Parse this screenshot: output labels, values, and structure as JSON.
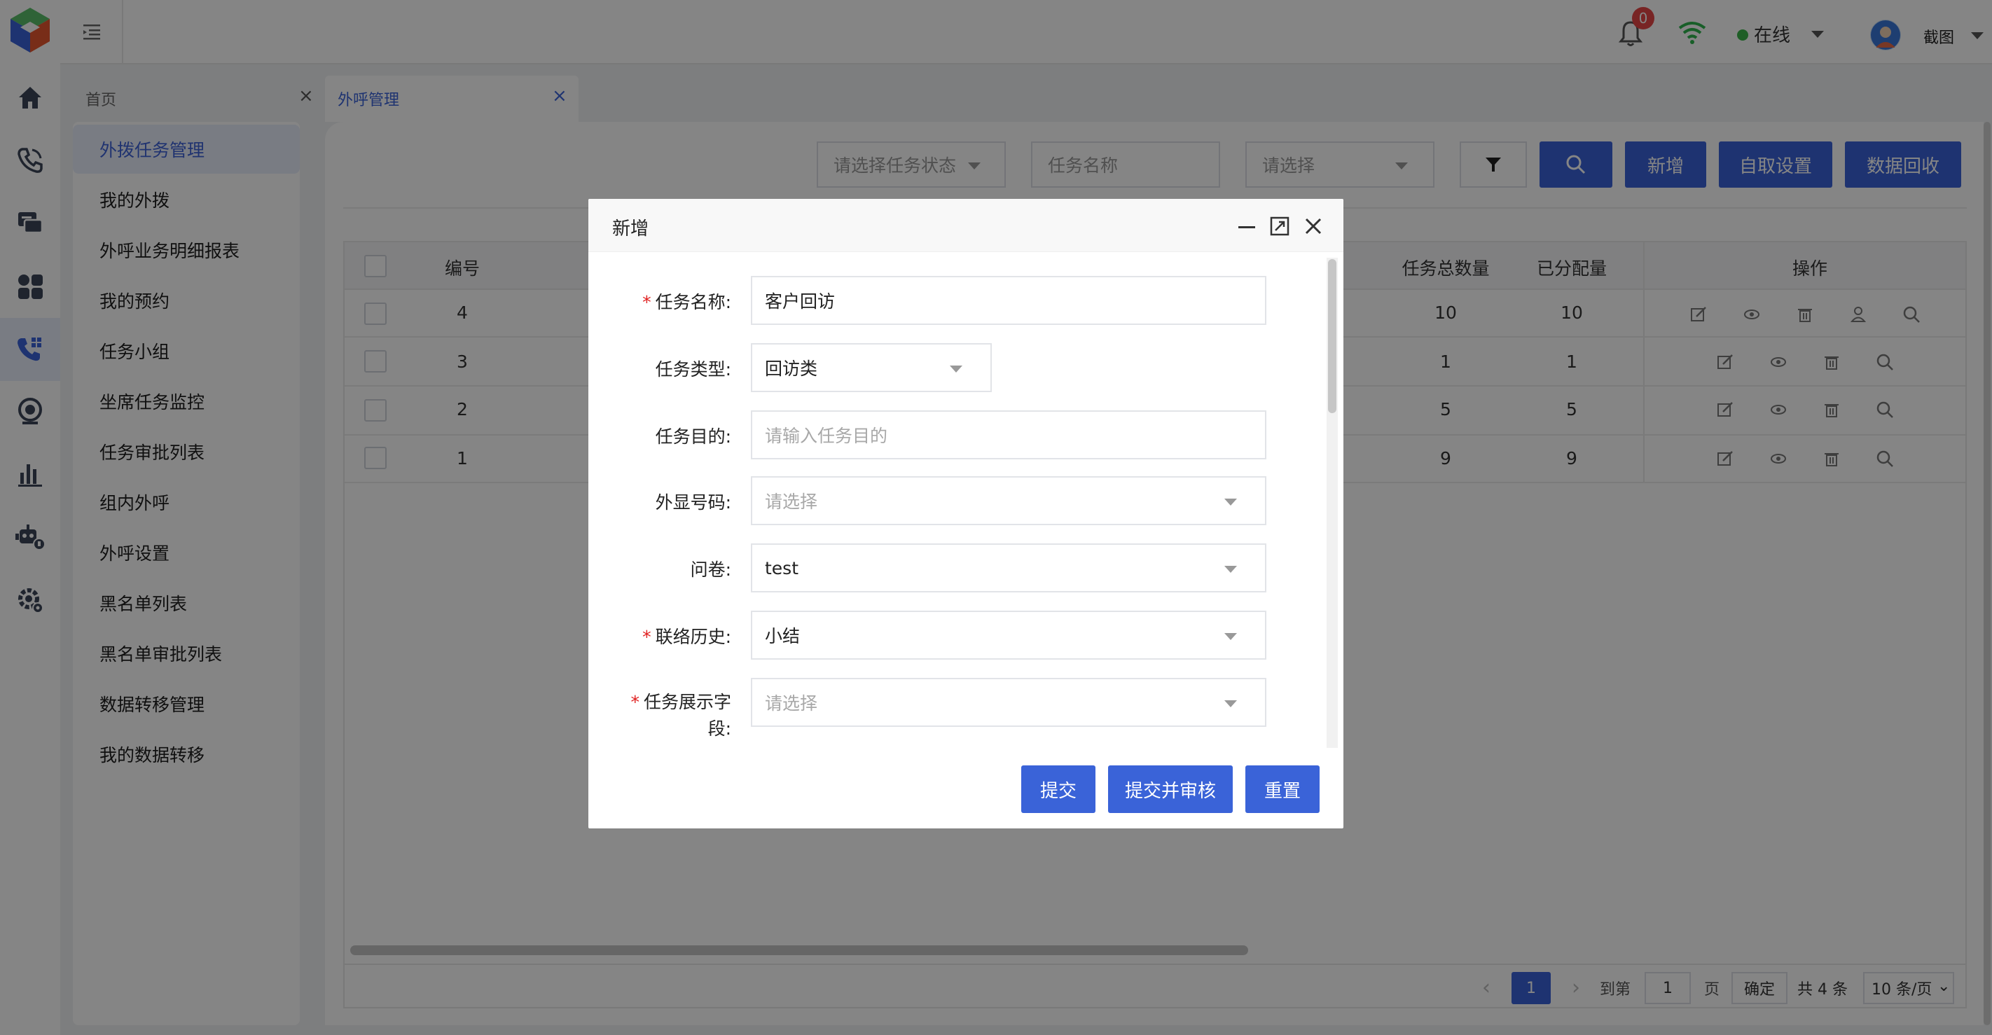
{
  "header": {
    "notification_count": "0",
    "status_label": "在线",
    "user_name": "截图",
    "status_color": "#3bb54a",
    "wifi_color": "#2fb44e"
  },
  "rail": {
    "icons": [
      "logo-icon",
      "home-icon",
      "phone-icon",
      "chat-icon",
      "apps-icon",
      "call-task-icon",
      "monitor-icon",
      "chart-icon",
      "robot-icon",
      "settings-icon"
    ]
  },
  "sidebar": {
    "items": [
      {
        "label": "外拨任务管理",
        "active": true
      },
      {
        "label": "我的外拨"
      },
      {
        "label": "外呼业务明细报表"
      },
      {
        "label": "我的预约"
      },
      {
        "label": "任务小组"
      },
      {
        "label": "坐席任务监控"
      },
      {
        "label": "任务审批列表"
      },
      {
        "label": "组内外呼"
      },
      {
        "label": "外呼设置"
      },
      {
        "label": "黑名单列表"
      },
      {
        "label": "黑名单审批列表"
      },
      {
        "label": "数据转移管理"
      },
      {
        "label": "我的数据转移"
      }
    ]
  },
  "tabs": [
    {
      "label": "首页"
    },
    {
      "label": "外呼管理",
      "active": true
    }
  ],
  "filters": {
    "status_placeholder": "请选择任务状态",
    "name_placeholder": "任务名称",
    "select_placeholder": "请选择"
  },
  "toolbar": {
    "add_label": "新增",
    "self_fetch_label": "自取设置",
    "recycle_label": "数据回收"
  },
  "table": {
    "headers": {
      "id": "编号",
      "total": "任务总数量",
      "assigned": "已分配量",
      "actions": "操作"
    },
    "rows": [
      {
        "id": "4",
        "total": "10",
        "assigned": "10"
      },
      {
        "id": "3",
        "total": "1",
        "assigned": "1"
      },
      {
        "id": "2",
        "total": "5",
        "assigned": "5"
      },
      {
        "id": "1",
        "total": "9",
        "assigned": "9"
      }
    ]
  },
  "pagination": {
    "current_page": "1",
    "goto_label": "到第",
    "goto_value": "1",
    "page_unit": "页",
    "confirm_label": "确定",
    "total_label": "共 4 条",
    "page_size": "10 条/页"
  },
  "modal": {
    "title": "新增",
    "fields": [
      {
        "label": "任务名称:",
        "required": true,
        "value": "客户回访",
        "placeholder": ""
      },
      {
        "label": "任务类型:",
        "required": false,
        "value": "回访类",
        "placeholder": ""
      },
      {
        "label": "任务目的:",
        "required": false,
        "value": "",
        "placeholder": "请输入任务目的"
      },
      {
        "label": "外显号码:",
        "required": false,
        "value": "",
        "placeholder": "请选择"
      },
      {
        "label": "问卷:",
        "required": false,
        "value": "test",
        "placeholder": ""
      },
      {
        "label": "联络历史:",
        "required": true,
        "value": "小结",
        "placeholder": ""
      },
      {
        "label_line1": "任务展示字",
        "label_line2": "段:",
        "required": true,
        "value": "",
        "placeholder": "请选择"
      }
    ],
    "submit_label": "提交",
    "submit_review_label": "提交并审核",
    "reset_label": "重置"
  },
  "colors": {
    "accent": "#3a63d8",
    "required": "#e02020",
    "badge": "#e64545"
  }
}
